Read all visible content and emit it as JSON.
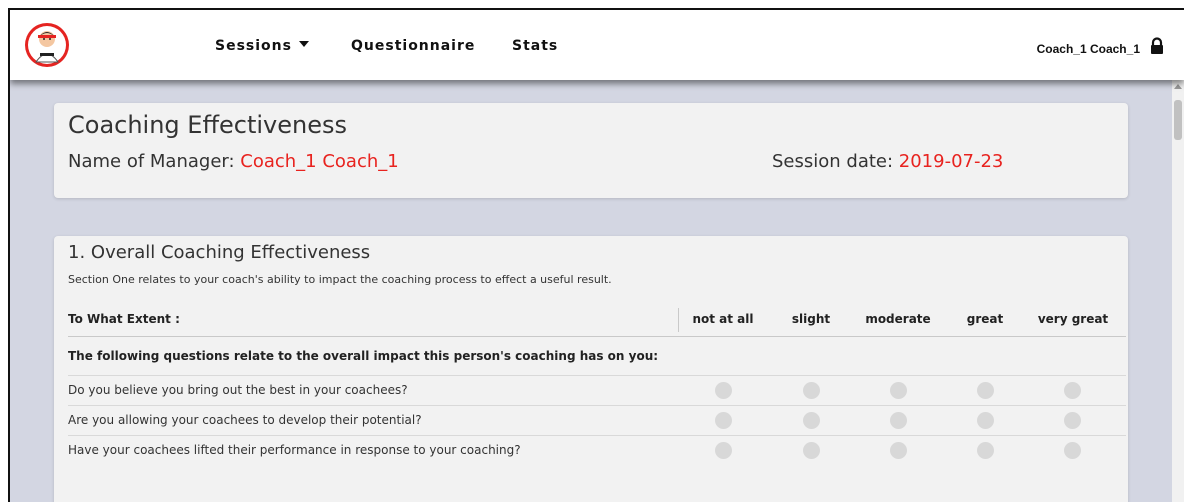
{
  "navbar": {
    "logo": "karate-kid-logo",
    "links": [
      {
        "label": "Sessions",
        "dropdown": true
      },
      {
        "label": "Questionnaire"
      },
      {
        "label": "Stats"
      }
    ],
    "user_name": "Coach_1 Coach_1",
    "lock_icon": "lock-icon"
  },
  "header": {
    "title": "Coaching Effectiveness",
    "manager_label": "Name of Manager: ",
    "manager_value": "Coach_1 Coach_1",
    "date_label": "Session date: ",
    "date_value": "2019-07-23"
  },
  "section": {
    "title": "1. Overall Coaching Effectiveness",
    "description": "Section One relates to your coach's ability to impact the coaching process to effect a useful result.",
    "table_header": "To What Extent :",
    "columns": [
      "not at all",
      "slight",
      "moderate",
      "great",
      "very great"
    ],
    "group_label": "The following questions relate to the overall impact this person's coaching has on you:",
    "questions": [
      "Do you believe you bring out the best in your coachees?",
      "Are you allowing your coachees to develop their potential?",
      "Have your coachees lifted their performance in response to your coaching?"
    ]
  },
  "colors": {
    "accent_red": "#e8231f",
    "background": "#d3d6e2",
    "card": "#f2f2f2"
  }
}
